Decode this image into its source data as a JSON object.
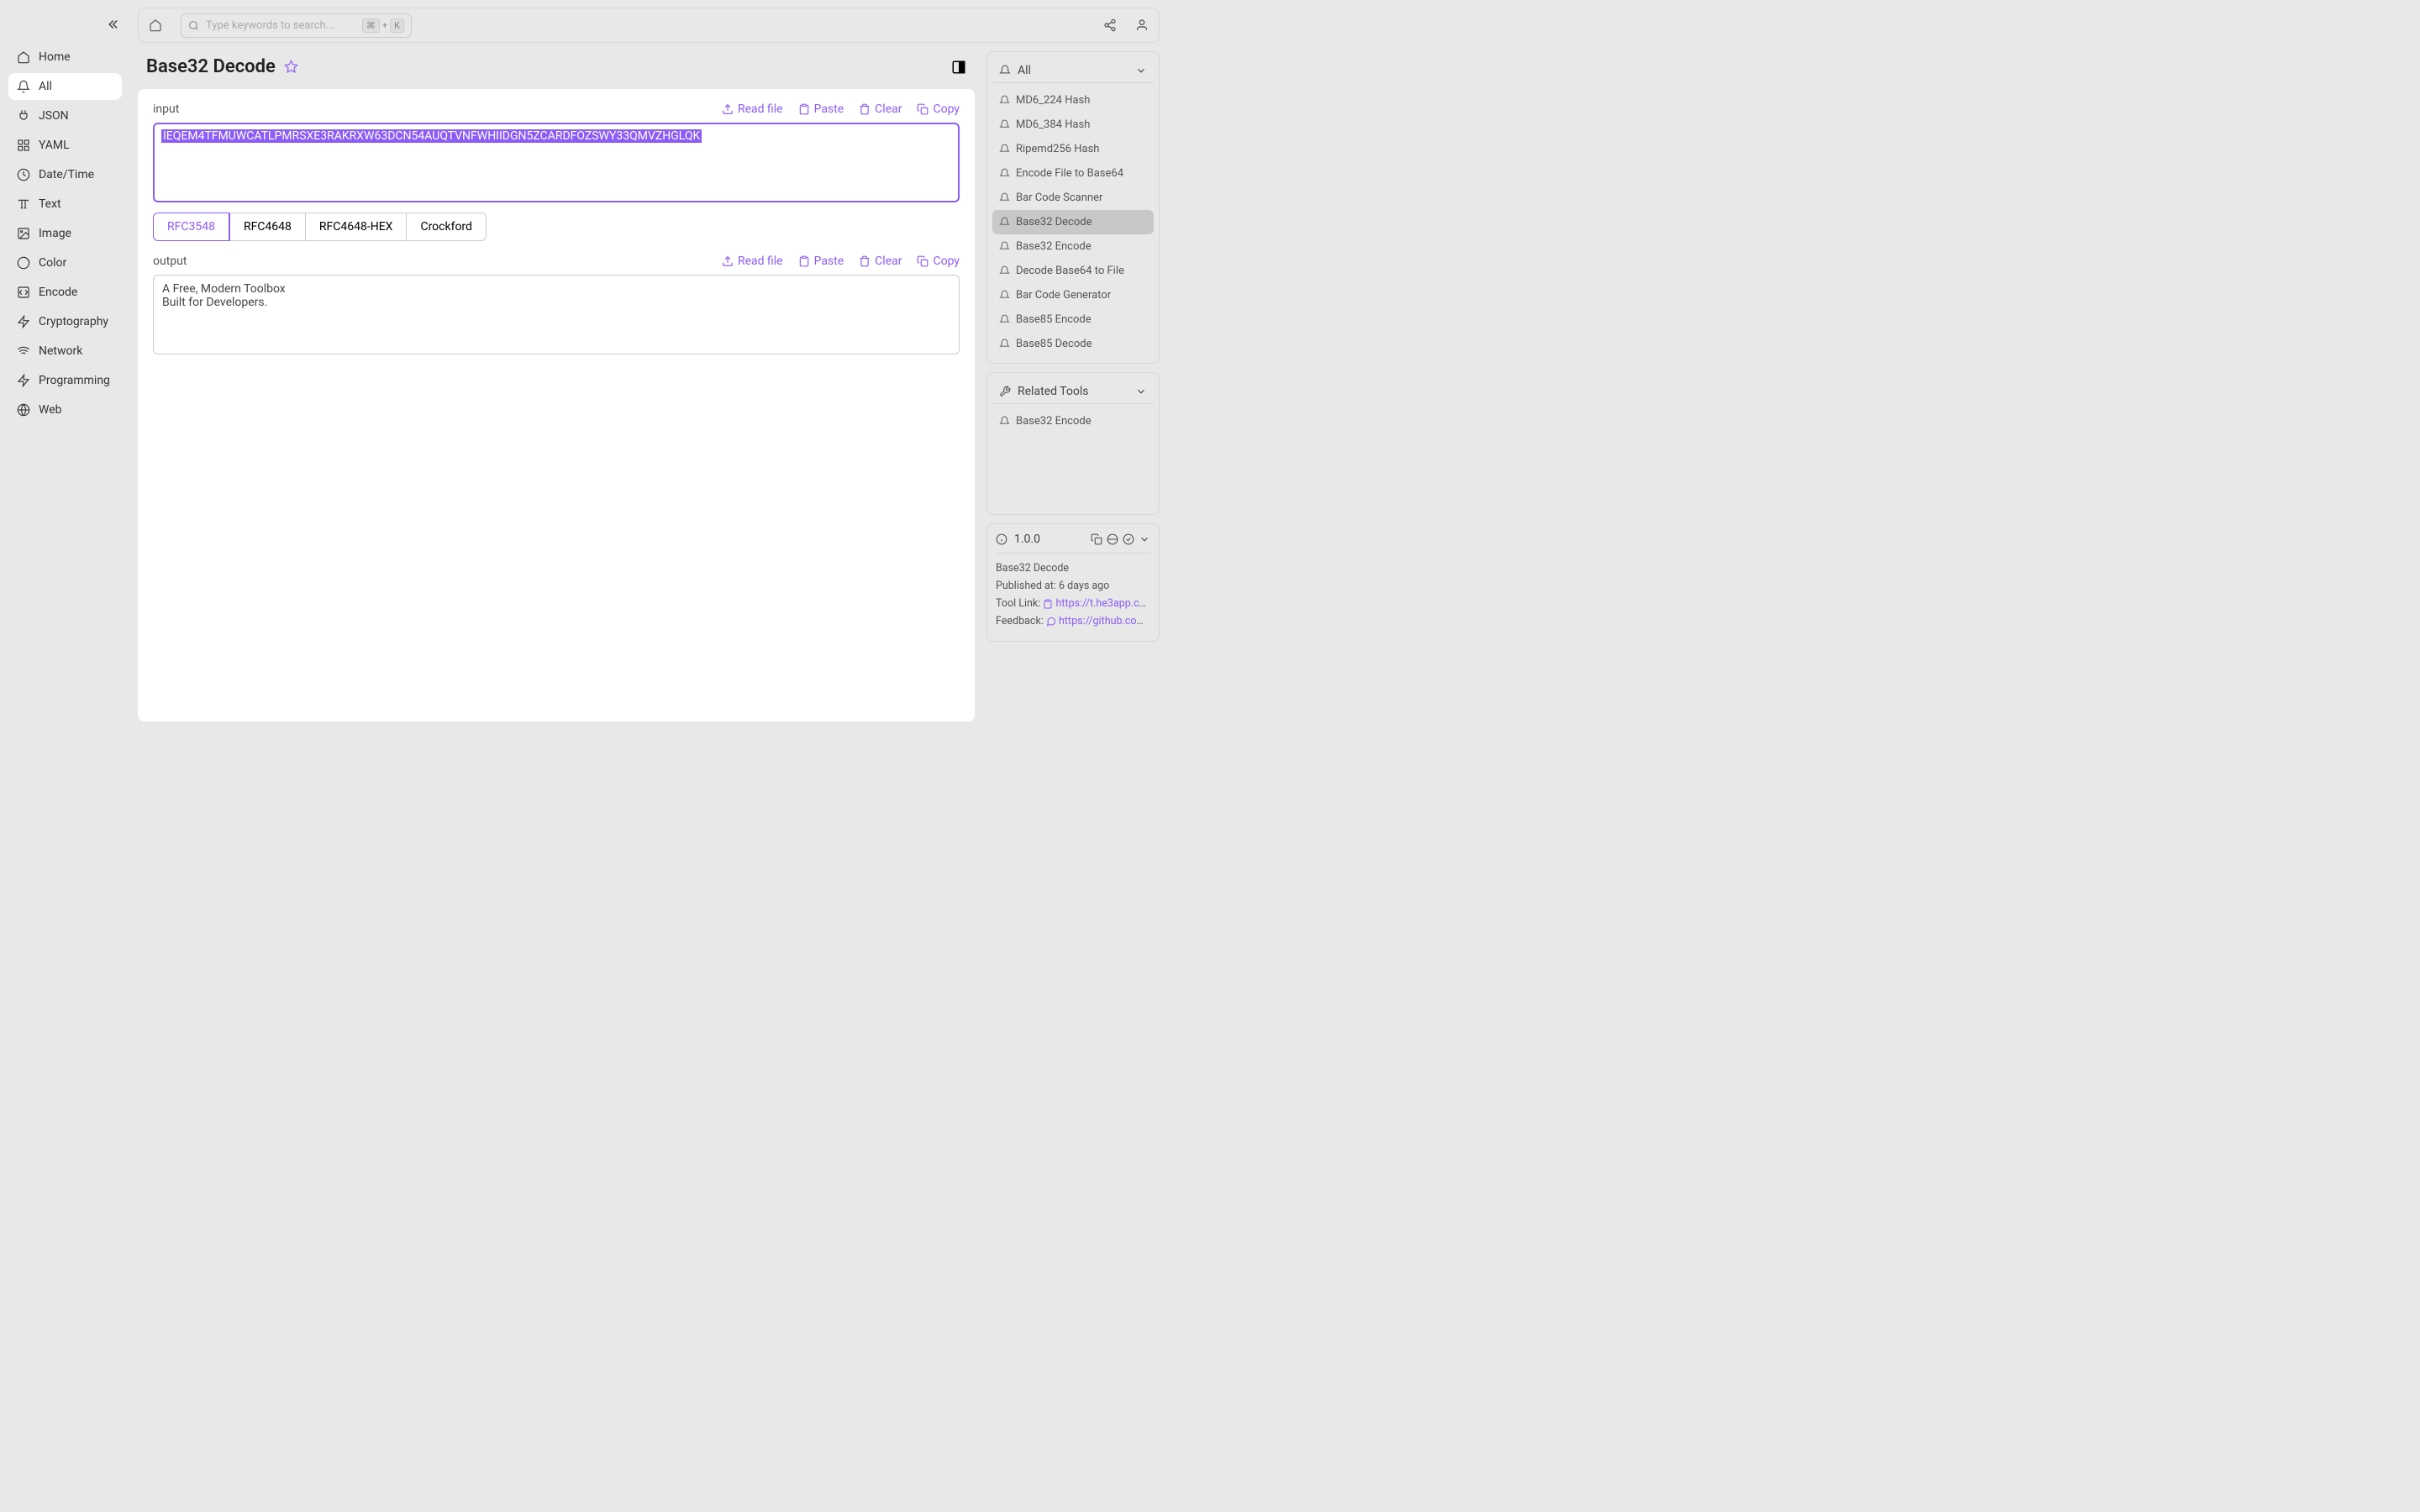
{
  "app": {
    "search_placeholder": "Type keywords to search...",
    "kbd_mod": "⌘",
    "kbd_plus": "+",
    "kbd_k": "K"
  },
  "sidebar": {
    "items": [
      {
        "label": "Home"
      },
      {
        "label": "All"
      },
      {
        "label": "JSON"
      },
      {
        "label": "YAML"
      },
      {
        "label": "Date/Time"
      },
      {
        "label": "Text"
      },
      {
        "label": "Image"
      },
      {
        "label": "Color"
      },
      {
        "label": "Encode"
      },
      {
        "label": "Cryptography"
      },
      {
        "label": "Network"
      },
      {
        "label": "Programming"
      },
      {
        "label": "Web"
      }
    ]
  },
  "page": {
    "title": "Base32 Decode",
    "input_label": "input",
    "output_label": "output",
    "input_value": "IEQEM4TFMUWCATLPMRSXE3RAKRXW63DCN54AUQTVNFWHIIDGN5ZCARDFOZSWY33QMVZHGLQK",
    "output_value": "A Free, Modern Toolbox\nBuilt for Developers.",
    "actions": {
      "read_file": "Read file",
      "paste": "Paste",
      "clear": "Clear",
      "copy": "Copy"
    },
    "modes": [
      "RFC3548",
      "RFC4648",
      "RFC4648-HEX",
      "Crockford"
    ]
  },
  "right": {
    "all_header": "All",
    "tools": [
      "MD6_224 Hash",
      "MD6_384 Hash",
      "Ripemd256 Hash",
      "Encode File to Base64",
      "Bar Code Scanner",
      "Base32 Decode",
      "Base32 Encode",
      "Decode Base64 to File",
      "Bar Code Generator",
      "Base85 Encode",
      "Base85 Decode"
    ],
    "related_header": "Related Tools",
    "related": [
      "Base32 Encode"
    ],
    "info": {
      "version": "1.0.0",
      "name": "Base32 Decode",
      "published_label": "Published at:",
      "published_value": "6 days ago",
      "tool_link_label": "Tool Link:",
      "tool_link_value": "https://t.he3app.co...",
      "feedback_label": "Feedback:",
      "feedback_value": "https://github.com/..."
    }
  }
}
